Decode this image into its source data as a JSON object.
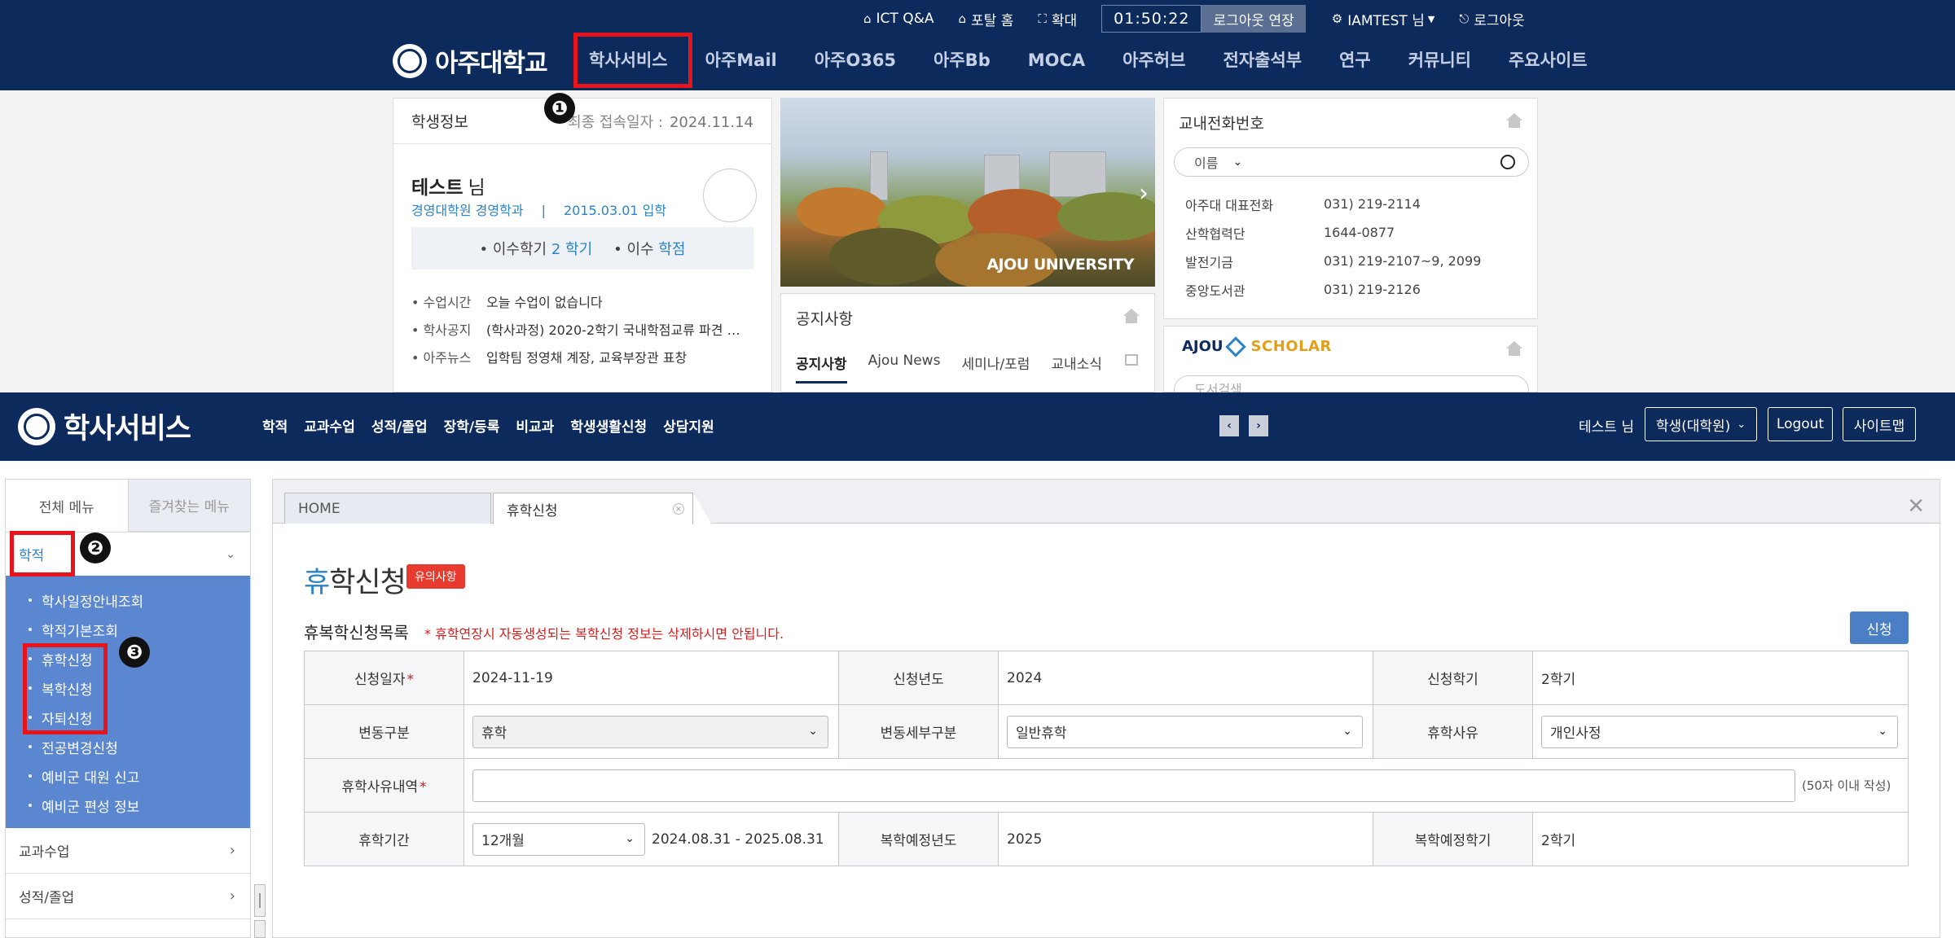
{
  "portal": {
    "util": {
      "ict_qa": "ICT Q&A",
      "portal_home": "포탈 홈",
      "zoom": "확대",
      "timer": "01:50:22",
      "extend_login": "로그아웃 연장",
      "user": "IAMTEST 님",
      "logout": "로그아웃"
    },
    "logo_text": "아주대학교",
    "nav": [
      "학사서비스",
      "아주Mail",
      "아주O365",
      "아주Bb",
      "MOCA",
      "아주허브",
      "전자출석부",
      "연구",
      "커뮤니티",
      "주요사이트"
    ],
    "student_info": {
      "title": "학생정보",
      "last_login_label": "최종 접속일자 :",
      "last_login_date": "2024.11.14",
      "name": "테스트",
      "name_suffix": "님",
      "dept": "경영대학원 경영학과",
      "sep": "|",
      "entry": "2015.03.01 입학",
      "semester_label": "• 이수학기",
      "semester_value": "2",
      "semester_unit": "학기",
      "credit_label": "• 이수",
      "credit_unit": "학점",
      "rows": [
        {
          "label": "• 수업시간",
          "value": "오늘 수업이 없습니다"
        },
        {
          "label": "• 학사공지",
          "value": "(학사과정) 2020-2학기 국내학점교류 파견 …"
        },
        {
          "label": "• 아주뉴스",
          "value": "입학팀 정영채 계장, 교육부장관 표창"
        }
      ]
    },
    "photo_caption": "AJOU UNIVERSITY",
    "notice": {
      "title": "공지사항",
      "tabs": [
        "공지사항",
        "Ajou News",
        "세미나/포럼",
        "교내소식"
      ]
    },
    "phone": {
      "title": "교내전화번호",
      "search_option": "이름",
      "rows": [
        {
          "name": "아주대 대표전화",
          "number": "031) 219-2114"
        },
        {
          "name": "산학협력단",
          "number": "1644-0877"
        },
        {
          "name": "발전기금",
          "number": "031) 219-2107~9, 2099"
        },
        {
          "name": "중앙도서관",
          "number": "031) 219-2126"
        }
      ]
    },
    "scholar": {
      "ajou": "AJOU",
      "scholar": "SCHOLAR",
      "search_placeholder": "도서검색"
    }
  },
  "markers": {
    "m1": "❶",
    "m2": "❷",
    "m3": "❸"
  },
  "ss": {
    "logo_text": "학사서비스",
    "nav": [
      "학적",
      "교과수업",
      "성적/졸업",
      "장학/등록",
      "비교과",
      "학생생활신청",
      "상담지원"
    ],
    "user": "테스트 님",
    "role": "학생(대학원)",
    "logout": "Logout",
    "sitemap": "사이트맵"
  },
  "sidebar": {
    "tabs": [
      "전체 메뉴",
      "즐겨찾는 메뉴"
    ],
    "group": "학적",
    "sub_items": [
      "학사일정안내조회",
      "학적기본조회",
      "휴학신청",
      "복학신청",
      "자퇴신청",
      "전공변경신청",
      "예비군 대원 신고",
      "예비군 편성 정보"
    ],
    "others": [
      "교과수업",
      "성적/졸업"
    ]
  },
  "work": {
    "tabs": {
      "home": "HOME",
      "active": "휴학신청"
    },
    "title_first": "휴",
    "title_rest": "학신청",
    "badge": "유의사항",
    "section_title": "휴복학신청목록",
    "warning": "* 휴학연장시 자동생성되는 복학신청 정보는 삭제하시면 안됩니다.",
    "apply": "신청",
    "form": {
      "apply_date_label": "신청일자",
      "apply_date": "2024-11-19",
      "apply_year_label": "신청년도",
      "apply_year": "2024",
      "apply_sem_label": "신청학기",
      "apply_sem": "2학기",
      "change_type_label": "변동구분",
      "change_type": "휴학",
      "change_detail_label": "변동세부구분",
      "change_detail": "일반휴학",
      "reason_label": "휴학사유",
      "reason": "개인사정",
      "reason_detail_label": "휴학사유내역",
      "reason_detail": "",
      "reason_hint": "(50자 이내 작성)",
      "period_label": "휴학기간",
      "period": "12개월",
      "period_range": "2024.08.31 - 2025.08.31",
      "return_year_label": "복학예정년도",
      "return_year": "2025",
      "return_sem_label": "복학예정학기",
      "return_sem": "2학기"
    }
  }
}
